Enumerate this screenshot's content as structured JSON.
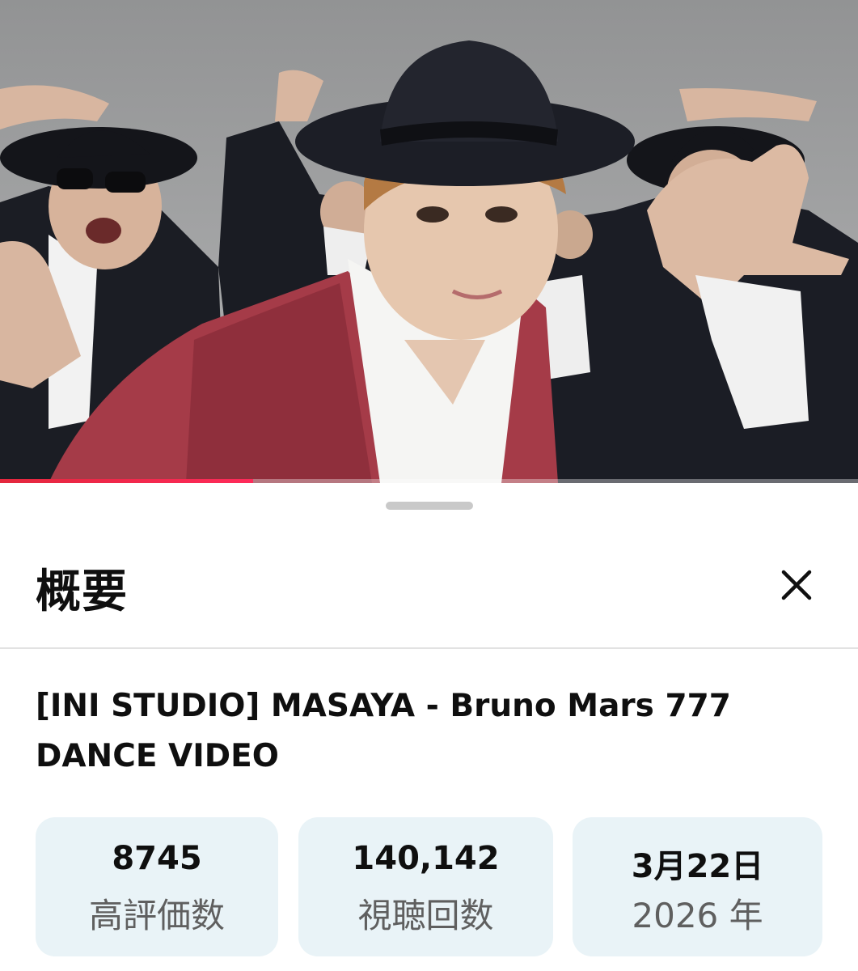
{
  "video": {
    "thumbnail_alt": "Dance video still",
    "progress_percent": 29.5,
    "progress_color": "#ff2a5a"
  },
  "sheet": {
    "title": "概要",
    "close_icon": "close-icon"
  },
  "details": {
    "video_title": "[INI STUDIO] MASAYA - Bruno Mars 777 DANCE VIDEO",
    "stats": [
      {
        "value": "8745",
        "label": "高評価数"
      },
      {
        "value": "140,142",
        "label": "視聴回数"
      },
      {
        "value": "3月22日",
        "label": "2026 年"
      }
    ]
  }
}
